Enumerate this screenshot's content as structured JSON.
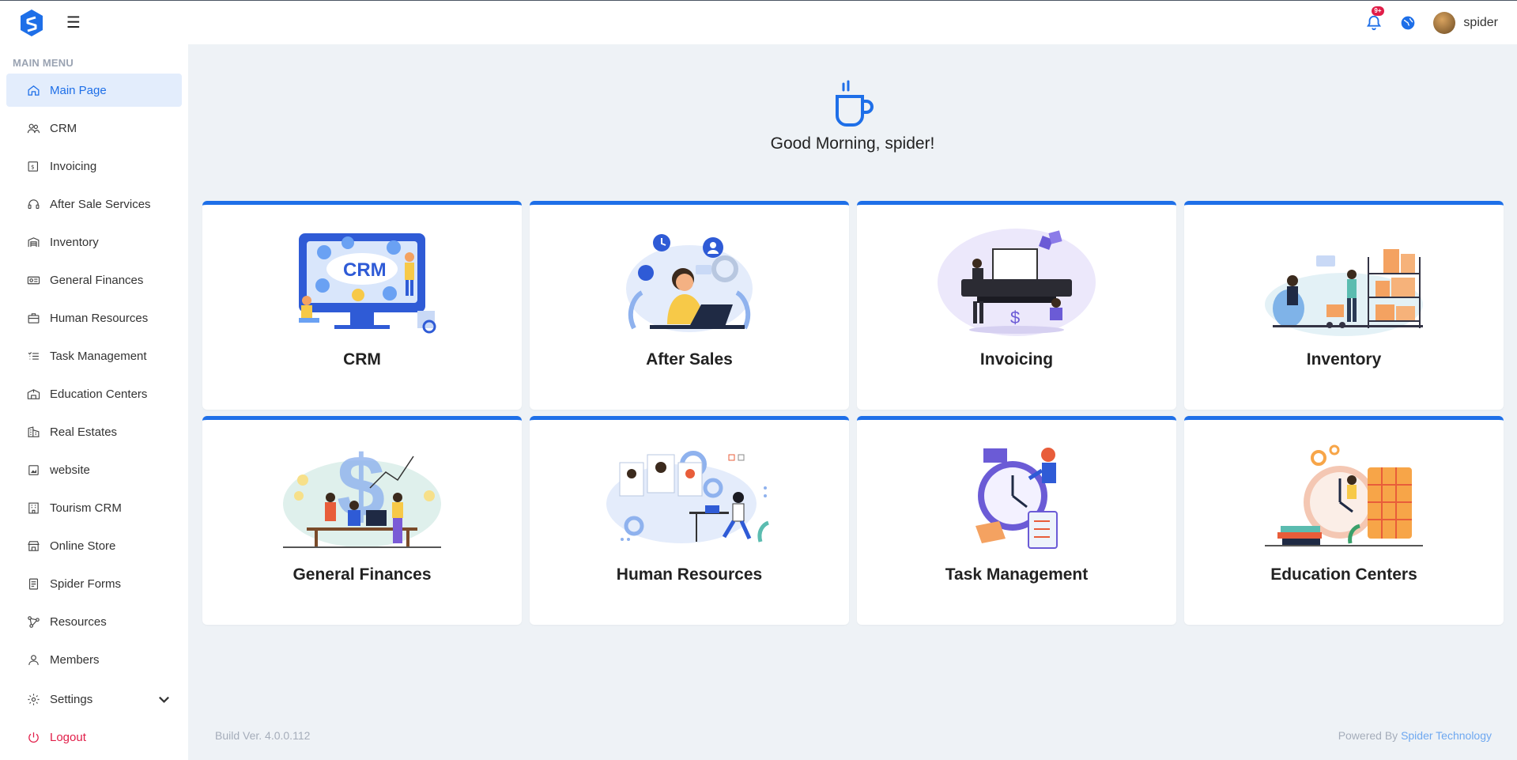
{
  "header": {
    "notification_badge": "9+",
    "username": "spider"
  },
  "sidebar": {
    "title": "MAIN MENU",
    "items": [
      {
        "label": "Main Page",
        "icon": "home-icon"
      },
      {
        "label": "CRM",
        "icon": "users-icon"
      },
      {
        "label": "Invoicing",
        "icon": "invoice-icon"
      },
      {
        "label": "After Sale Services",
        "icon": "headset-icon"
      },
      {
        "label": "Inventory",
        "icon": "warehouse-icon"
      },
      {
        "label": "General Finances",
        "icon": "money-icon"
      },
      {
        "label": "Human Resources",
        "icon": "briefcase-icon"
      },
      {
        "label": "Task Management",
        "icon": "checklist-icon"
      },
      {
        "label": "Education Centers",
        "icon": "school-icon"
      },
      {
        "label": "Real Estates",
        "icon": "building-icon"
      },
      {
        "label": "website",
        "icon": "image-icon"
      },
      {
        "label": "Tourism CRM",
        "icon": "hotel-icon"
      },
      {
        "label": "Online Store",
        "icon": "store-icon"
      },
      {
        "label": "Spider Forms",
        "icon": "forms-icon"
      },
      {
        "label": "Resources",
        "icon": "network-icon"
      },
      {
        "label": "Members",
        "icon": "person-icon"
      }
    ],
    "settings_label": "Settings",
    "logout_label": "Logout"
  },
  "welcome": {
    "greeting": "Good Morning, spider!"
  },
  "cards": [
    {
      "title": "CRM",
      "illustration": "crm-illustration"
    },
    {
      "title": "After Sales",
      "illustration": "after-sales-illustration"
    },
    {
      "title": "Invoicing",
      "illustration": "invoicing-illustration"
    },
    {
      "title": "Inventory",
      "illustration": "inventory-illustration"
    },
    {
      "title": "General Finances",
      "illustration": "finances-illustration"
    },
    {
      "title": "Human Resources",
      "illustration": "hr-illustration"
    },
    {
      "title": "Task Management",
      "illustration": "task-illustration"
    },
    {
      "title": "Education Centers",
      "illustration": "education-illustration"
    }
  ],
  "footer": {
    "build": "Build Ver. 4.0.0.112",
    "powered_prefix": "Powered By",
    "powered_link": "Spider Technology"
  },
  "colors": {
    "accent": "#1e6fe8",
    "active_bg": "#e3edfc",
    "logout": "#e11d48",
    "page_bg": "#eef2f6"
  }
}
